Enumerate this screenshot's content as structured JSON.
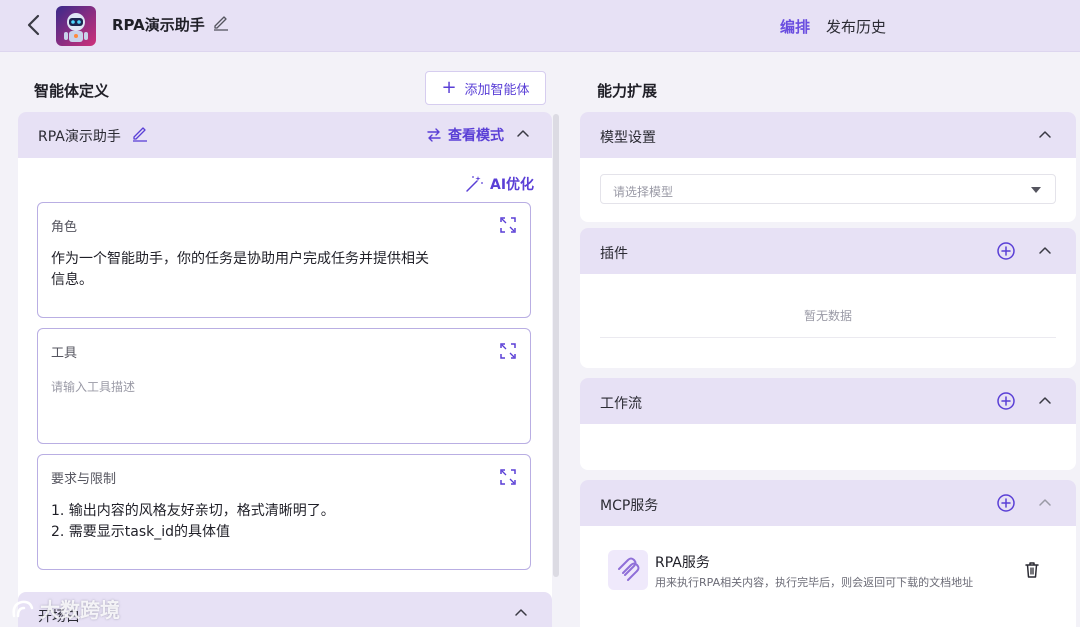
{
  "header": {
    "app_title": "RPA演示助手",
    "tabs": [
      {
        "label": "编排",
        "active": true
      },
      {
        "label": "发布历史",
        "active": false
      }
    ]
  },
  "left": {
    "section_title": "智能体定义",
    "add_agent_label": "添加智能体",
    "agent": {
      "name": "RPA演示助手",
      "view_mode_label": "查看模式",
      "ai_optimize_label": "AI优化",
      "cards": [
        {
          "label": "角色",
          "value": "作为一个智能助手，你的任务是协助用户完成任务并提供相关\n信息。",
          "placeholder": ""
        },
        {
          "label": "工具",
          "value": "",
          "placeholder": "请输入工具描述"
        },
        {
          "label": "要求与限制",
          "value": "1. 输出内容的风格友好亲切，格式清晰明了。\n2. 需要显示task_id的具体值",
          "placeholder": ""
        }
      ]
    },
    "opening_label": "开场白"
  },
  "right": {
    "section_title": "能力扩展",
    "model": {
      "title": "模型设置",
      "placeholder": "请选择模型"
    },
    "plugins": {
      "title": "插件",
      "empty": "暂无数据"
    },
    "workflow": {
      "title": "工作流"
    },
    "mcp": {
      "title": "MCP服务",
      "items": [
        {
          "name": "RPA服务",
          "desc": "用来执行RPA相关内容，执行完毕后，则会返回可下载的文档地址"
        }
      ]
    }
  },
  "watermark": "大数跨境",
  "colors": {
    "accent": "#5a3fd6",
    "header_bg": "#e7e1f5",
    "card_border": "#b9aee3"
  }
}
